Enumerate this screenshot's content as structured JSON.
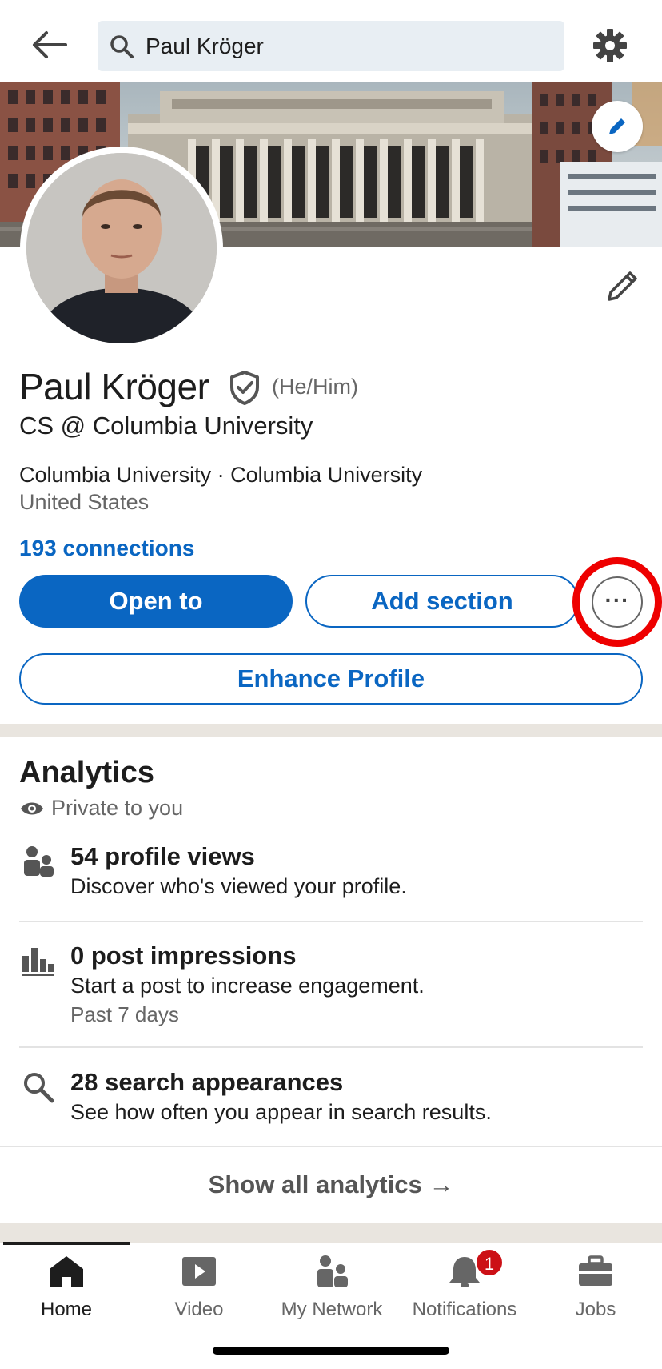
{
  "search": {
    "value": "Paul Kröger"
  },
  "profile": {
    "name": "Paul Kröger",
    "pronouns": "(He/Him)",
    "headline": "CS @ Columbia University",
    "education_line": "Columbia University · Columbia University",
    "location": "United States",
    "connections": "193 connections"
  },
  "actions": {
    "open_to": "Open to",
    "add_section": "Add section",
    "more": "···",
    "enhance": "Enhance Profile"
  },
  "analytics": {
    "title": "Analytics",
    "privacy": "Private to you",
    "items": [
      {
        "title": "54 profile views",
        "subtitle": "Discover who's viewed your profile.",
        "meta": ""
      },
      {
        "title": "0 post impressions",
        "subtitle": "Start a post to increase engagement.",
        "meta": "Past 7 days"
      },
      {
        "title": "28 search appearances",
        "subtitle": "See how often you appear in search results.",
        "meta": ""
      }
    ],
    "show_all": "Show all analytics →"
  },
  "nav": {
    "items": [
      {
        "label": "Home",
        "icon": "home-icon",
        "active": true
      },
      {
        "label": "Video",
        "icon": "video-icon",
        "active": false
      },
      {
        "label": "My Network",
        "icon": "network-icon",
        "active": false
      },
      {
        "label": "Notifications",
        "icon": "bell-icon",
        "active": false
      },
      {
        "label": "Jobs",
        "icon": "briefcase-icon",
        "active": false
      }
    ],
    "notification_badge": "1"
  },
  "colors": {
    "brand_blue": "#0a66c2",
    "highlight_red": "#ee0000",
    "badge_red": "#cc1016"
  }
}
